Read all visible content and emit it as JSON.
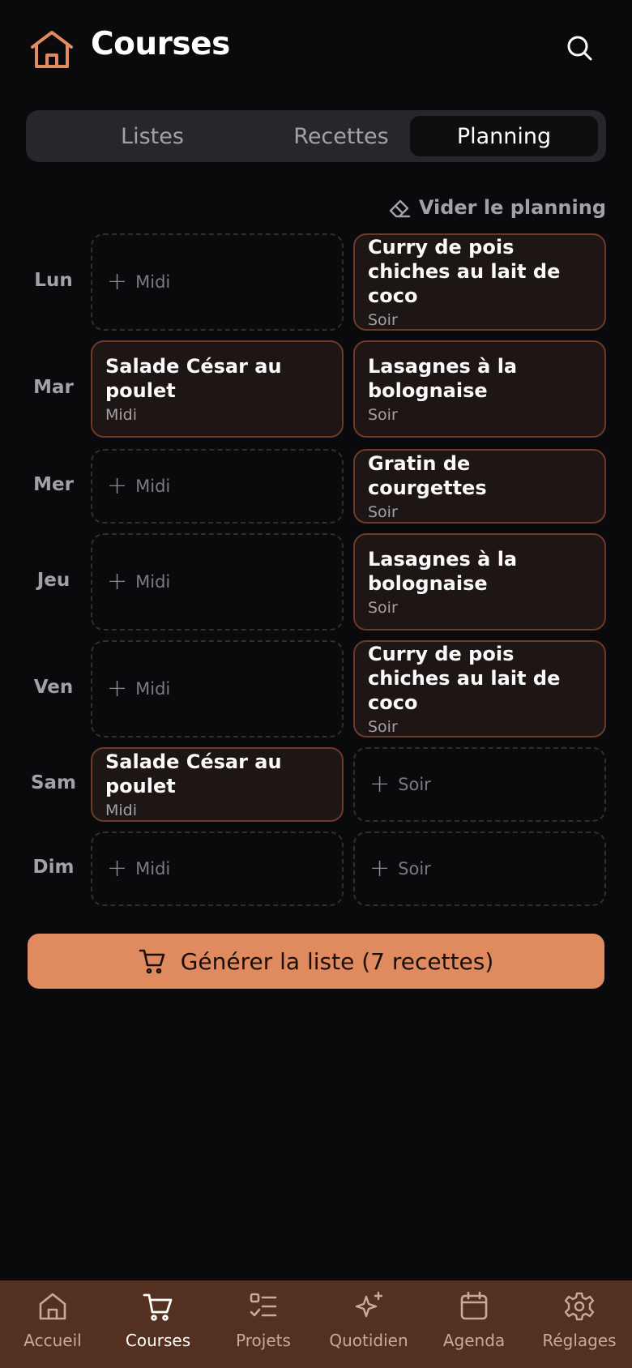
{
  "header": {
    "title": "Courses",
    "logo_icon": "house-icon",
    "search_icon": "search-icon"
  },
  "tabs": [
    {
      "label": "Listes",
      "active": false
    },
    {
      "label": "Recettes",
      "active": false
    },
    {
      "label": "Planning",
      "active": true
    }
  ],
  "clear_button": {
    "label": "Vider le planning",
    "icon": "eraser-icon"
  },
  "planning": {
    "days": [
      {
        "day": "Lun",
        "midi": {
          "recipe": null,
          "label": "Midi"
        },
        "soir": {
          "recipe": "Curry de pois chiches au lait de coco",
          "label": "Soir"
        }
      },
      {
        "day": "Mar",
        "midi": {
          "recipe": "Salade César au poulet",
          "label": "Midi"
        },
        "soir": {
          "recipe": "Lasagnes à la bolognaise",
          "label": "Soir"
        }
      },
      {
        "day": "Mer",
        "midi": {
          "recipe": null,
          "label": "Midi"
        },
        "soir": {
          "recipe": "Gratin de courgettes",
          "label": "Soir"
        }
      },
      {
        "day": "Jeu",
        "midi": {
          "recipe": null,
          "label": "Midi"
        },
        "soir": {
          "recipe": "Lasagnes à la bolognaise",
          "label": "Soir"
        }
      },
      {
        "day": "Ven",
        "midi": {
          "recipe": null,
          "label": "Midi"
        },
        "soir": {
          "recipe": "Curry de pois chiches au lait de coco",
          "label": "Soir"
        }
      },
      {
        "day": "Sam",
        "midi": {
          "recipe": "Salade César au poulet",
          "label": "Midi"
        },
        "soir": {
          "recipe": null,
          "label": "Soir"
        }
      },
      {
        "day": "Dim",
        "midi": {
          "recipe": null,
          "label": "Midi"
        },
        "soir": {
          "recipe": null,
          "label": "Soir"
        }
      }
    ],
    "add_symbol": "+"
  },
  "generate_button": {
    "label": "Générer la liste (7 recettes)",
    "icon": "cart-icon"
  },
  "bottom_nav": [
    {
      "label": "Accueil",
      "icon": "house-icon",
      "active": false
    },
    {
      "label": "Courses",
      "icon": "cart-icon",
      "active": true
    },
    {
      "label": "Projets",
      "icon": "checklist-icon",
      "active": false
    },
    {
      "label": "Quotidien",
      "icon": "sparkles-icon",
      "active": false
    },
    {
      "label": "Agenda",
      "icon": "calendar-icon",
      "active": false
    },
    {
      "label": "Réglages",
      "icon": "gear-icon",
      "active": false
    }
  ],
  "colors": {
    "accent": "#e08a5f",
    "background": "#0a0a0c",
    "nav_background": "#53301f",
    "card_background": "#1e1615",
    "card_border": "#6b3b28"
  }
}
